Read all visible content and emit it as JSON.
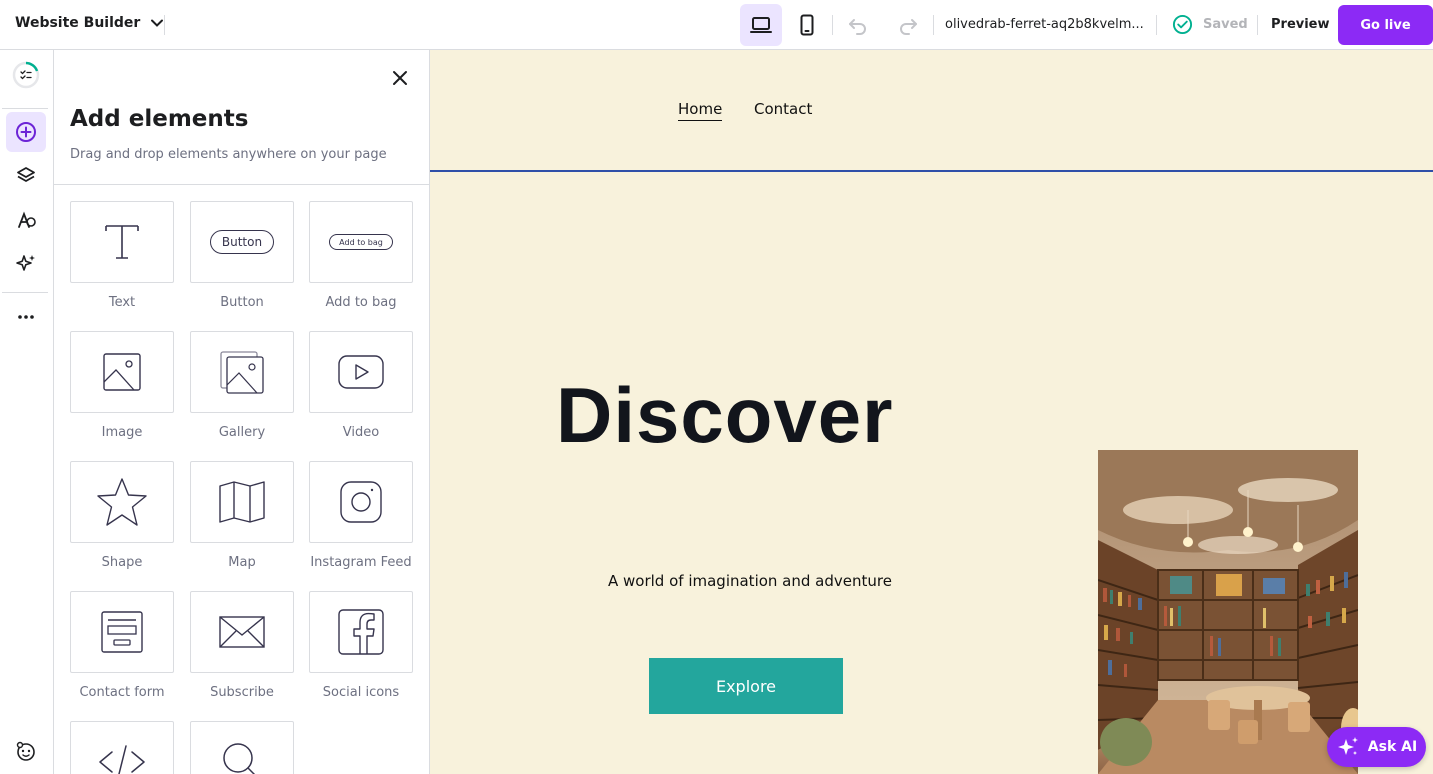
{
  "topbar": {
    "app_title": "Website Builder",
    "url": "olivedrab-ferret-aq2b8kvelm...",
    "saved_label": "Saved",
    "preview_label": "Preview",
    "golive_label": "Go live",
    "icons": [
      "chevron-down-icon",
      "desktop-icon",
      "mobile-icon",
      "undo-icon",
      "redo-icon",
      "check-circle-icon"
    ]
  },
  "sidebar": {
    "icons": [
      "checklist-icon",
      "add-circle-icon",
      "layers-icon",
      "palette-icon",
      "sparkle-icon",
      "more-icon",
      "help-icon"
    ]
  },
  "panel": {
    "title": "Add elements",
    "subtitle": "Drag and drop elements anywhere on your page",
    "tiles": [
      {
        "label": "Text",
        "icon": "text-icon"
      },
      {
        "label": "Button",
        "icon": "button-icon",
        "glyph": "Button"
      },
      {
        "label": "Add to bag",
        "icon": "add-to-bag-icon",
        "glyph": "Add to bag"
      },
      {
        "label": "Image",
        "icon": "image-icon"
      },
      {
        "label": "Gallery",
        "icon": "gallery-icon"
      },
      {
        "label": "Video",
        "icon": "video-icon"
      },
      {
        "label": "Shape",
        "icon": "star-icon"
      },
      {
        "label": "Map",
        "icon": "map-icon"
      },
      {
        "label": "Instagram Feed",
        "icon": "instagram-icon"
      },
      {
        "label": "Contact form",
        "icon": "contact-form-icon"
      },
      {
        "label": "Subscribe",
        "icon": "envelope-icon"
      },
      {
        "label": "Social icons",
        "icon": "facebook-icon"
      },
      {
        "label": "",
        "icon": "code-icon"
      },
      {
        "label": "",
        "icon": "search-icon"
      }
    ]
  },
  "canvas": {
    "nav": [
      "Home",
      "Contact"
    ],
    "hero_title": "Discover",
    "hero_subtitle": "A world of imagination and adventure",
    "cta_label": "Explore"
  },
  "ask_ai_label": "Ask AI",
  "colors": {
    "accent": "#8c2af5",
    "canvas_bg": "#f8f2dc",
    "cta": "#23a69d",
    "header_line": "#2f4fa8"
  }
}
